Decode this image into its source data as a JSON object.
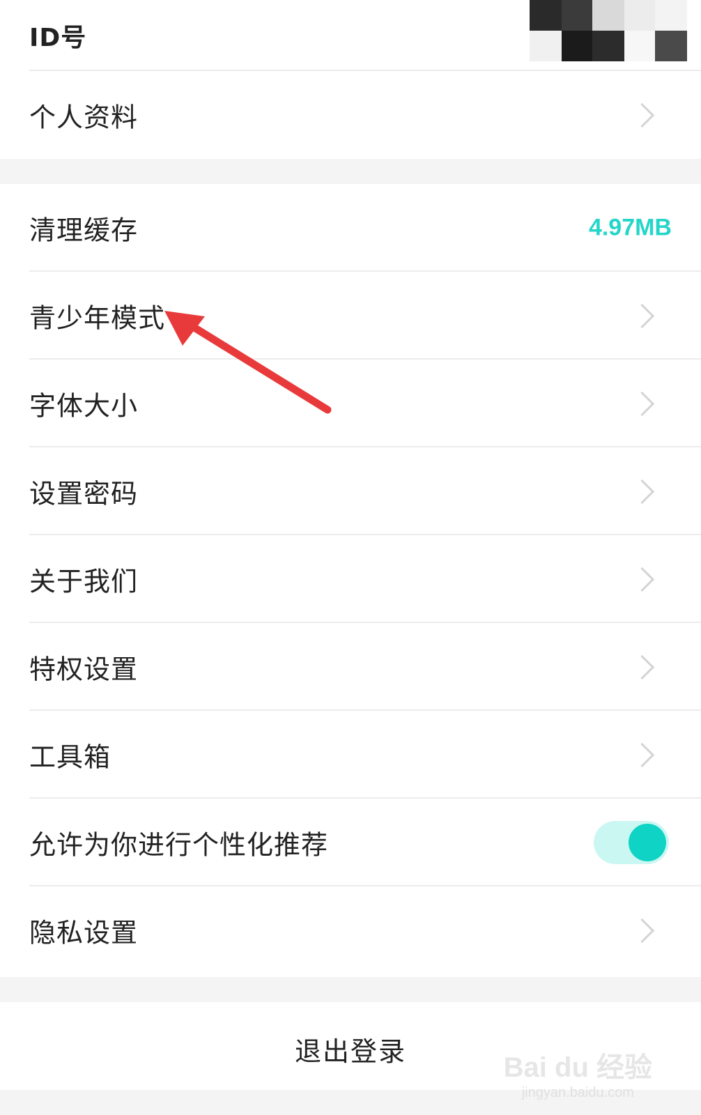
{
  "settings": {
    "id_label": "ID号",
    "profile_label": "个人资料",
    "cache": {
      "label": "清理缓存",
      "value": "4.97MB"
    },
    "menu_items": [
      "青少年模式",
      "字体大小",
      "设置密码",
      "关于我们",
      "特权设置",
      "工具箱"
    ],
    "personalized": {
      "label": "允许为你进行个性化推荐",
      "enabled": true
    },
    "privacy_label": "隐私设置",
    "logout_label": "退出登录"
  },
  "watermark": {
    "main": "Bai du 经验",
    "sub": "jingyan.baidu.com"
  },
  "colors": {
    "accent": "#25d6c8",
    "toggle_on": "#0fd3c5",
    "toggle_track": "#cbf7f3",
    "annotation_arrow": "#e83a3a"
  }
}
